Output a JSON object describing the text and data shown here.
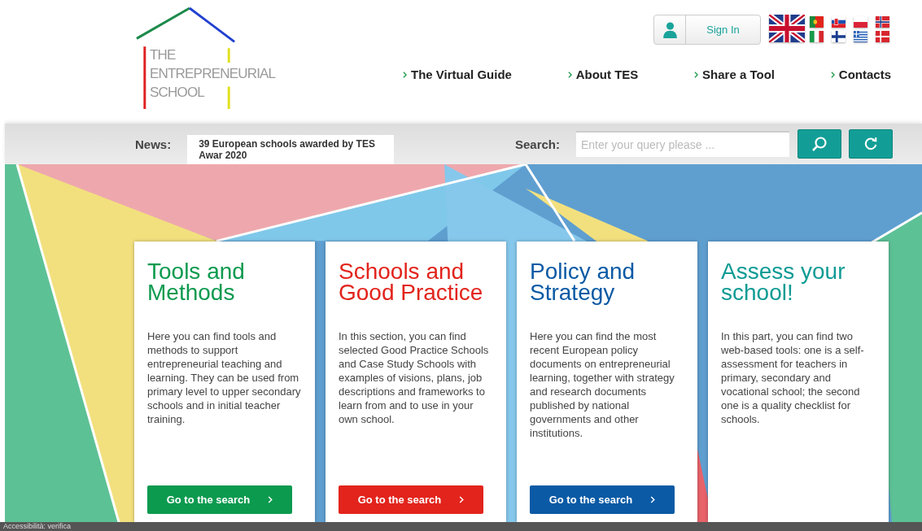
{
  "logo": {
    "lines": [
      "THE",
      "ENTREPRENEURIAL",
      "SCHOOL"
    ]
  },
  "sign_in": {
    "label": "Sign In"
  },
  "languages": [
    {
      "kind": "uk",
      "selected": true
    },
    {
      "kind": "pt",
      "selected": false
    },
    {
      "kind": "it",
      "selected": false
    },
    {
      "kind": "sk",
      "selected": false
    },
    {
      "kind": "fi",
      "selected": false
    },
    {
      "kind": "pl",
      "selected": false
    },
    {
      "kind": "gr",
      "selected": false
    },
    {
      "kind": "no",
      "selected": false
    },
    {
      "kind": "dk",
      "selected": false
    }
  ],
  "nav": [
    {
      "label": "The Virtual Guide"
    },
    {
      "label": "About TES"
    },
    {
      "label": "Share a Tool"
    },
    {
      "label": "Contacts"
    }
  ],
  "news": {
    "label": "News:",
    "value": "39 European schools awarded by TES Awar 2020"
  },
  "search": {
    "label": "Search:",
    "placeholder": "Enter your query please ..."
  },
  "cards": [
    {
      "title": "Tools and Methods",
      "color": "#0c9a4f",
      "text": "Here you can find tools and methods to support entrepreneurial teaching and learning. They can be used from primary level to upper secondary schools and in initial teacher training.",
      "button": "Go to the search"
    },
    {
      "title": "Schools and Good Practice",
      "color": "#e2241c",
      "text": "In this section, you can find selected Good Practice Schools and Case Study Schools with examples of visions, plans, job descriptions and frameworks to learn from and to use in your own school.",
      "button": "Go to the search"
    },
    {
      "title": "Policy and Strategy",
      "color": "#0a5aa5",
      "text": "Here you can find the most recent European policy documents on entrepreneurial learning, together with strategy and research documents published by national governments and other institutions.",
      "button": "Go to the search"
    },
    {
      "title": "Assess your school!",
      "color": "#0e9b94",
      "text": "In this part, you can find two web-based tools: one is a self-assessment for teachers in primary, secondary and vocational school; the second one is a quality checklist for schools."
    }
  ],
  "status_bar": {
    "text": "Accessibilità: verifica"
  }
}
